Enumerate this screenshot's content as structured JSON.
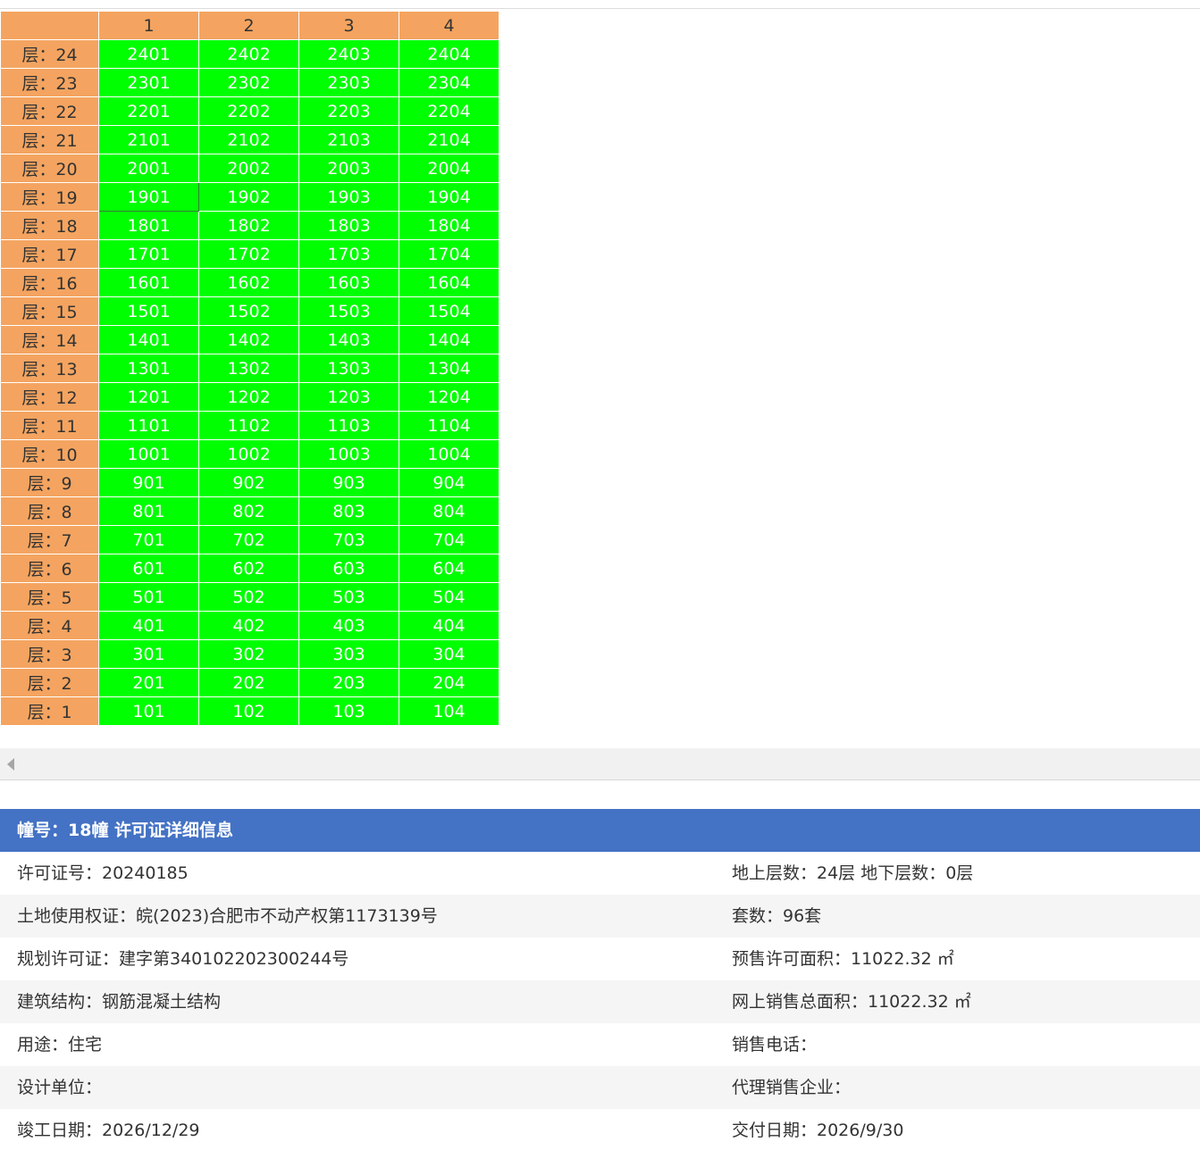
{
  "units_grid": {
    "columns": [
      "1",
      "2",
      "3",
      "4"
    ],
    "floors": [
      {
        "label": "层：24",
        "rooms": [
          "2401",
          "2402",
          "2403",
          "2404"
        ]
      },
      {
        "label": "层：23",
        "rooms": [
          "2301",
          "2302",
          "2303",
          "2304"
        ]
      },
      {
        "label": "层：22",
        "rooms": [
          "2201",
          "2202",
          "2203",
          "2204"
        ]
      },
      {
        "label": "层：21",
        "rooms": [
          "2101",
          "2102",
          "2103",
          "2104"
        ]
      },
      {
        "label": "层：20",
        "rooms": [
          "2001",
          "2002",
          "2003",
          "2004"
        ]
      },
      {
        "label": "层：19",
        "rooms": [
          "1901",
          "1902",
          "1903",
          "1904"
        ]
      },
      {
        "label": "层：18",
        "rooms": [
          "1801",
          "1802",
          "1803",
          "1804"
        ]
      },
      {
        "label": "层：17",
        "rooms": [
          "1701",
          "1702",
          "1703",
          "1704"
        ]
      },
      {
        "label": "层：16",
        "rooms": [
          "1601",
          "1602",
          "1603",
          "1604"
        ]
      },
      {
        "label": "层：15",
        "rooms": [
          "1501",
          "1502",
          "1503",
          "1504"
        ]
      },
      {
        "label": "层：14",
        "rooms": [
          "1401",
          "1402",
          "1403",
          "1404"
        ]
      },
      {
        "label": "层：13",
        "rooms": [
          "1301",
          "1302",
          "1303",
          "1304"
        ]
      },
      {
        "label": "层：12",
        "rooms": [
          "1201",
          "1202",
          "1203",
          "1204"
        ]
      },
      {
        "label": "层：11",
        "rooms": [
          "1101",
          "1102",
          "1103",
          "1104"
        ]
      },
      {
        "label": "层：10",
        "rooms": [
          "1001",
          "1002",
          "1003",
          "1004"
        ]
      },
      {
        "label": "层：9",
        "rooms": [
          "901",
          "902",
          "903",
          "904"
        ]
      },
      {
        "label": "层：8",
        "rooms": [
          "801",
          "802",
          "803",
          "804"
        ]
      },
      {
        "label": "层：7",
        "rooms": [
          "701",
          "702",
          "703",
          "704"
        ]
      },
      {
        "label": "层：6",
        "rooms": [
          "601",
          "602",
          "603",
          "604"
        ]
      },
      {
        "label": "层：5",
        "rooms": [
          "501",
          "502",
          "503",
          "504"
        ]
      },
      {
        "label": "层：4",
        "rooms": [
          "401",
          "402",
          "403",
          "404"
        ]
      },
      {
        "label": "层：3",
        "rooms": [
          "301",
          "302",
          "303",
          "304"
        ]
      },
      {
        "label": "层：2",
        "rooms": [
          "201",
          "202",
          "203",
          "204"
        ]
      },
      {
        "label": "层：1",
        "rooms": [
          "101",
          "102",
          "103",
          "104"
        ]
      }
    ],
    "colors": {
      "header_bg": "#f4a460",
      "available_room_bg": "#00ff00",
      "room_text": "#ffffff"
    }
  },
  "scrollbar": {
    "arrow_icon": "arrow-left-icon"
  },
  "permit_info": {
    "title": "幢号：18幢 许可证详细信息",
    "header_color": "#4472c4",
    "rows": [
      {
        "left": "许可证号：20240185",
        "right": "地上层数：24层  地下层数：0层"
      },
      {
        "left": "土地使用权证：皖(2023)合肥市不动产权第1173139号",
        "right": "套数：96套"
      },
      {
        "left": "规划许可证：建字第340102202300244号",
        "right": "预售许可面积：11022.32 ㎡"
      },
      {
        "left": "建筑结构：钢筋混凝土结构",
        "right": "网上销售总面积：11022.32 ㎡"
      },
      {
        "left": "用途：住宅",
        "right": "销售电话："
      },
      {
        "left": "设计单位：",
        "right": "代理销售企业："
      },
      {
        "left": "竣工日期：2026/12/29",
        "right": "交付日期：2026/9/30"
      }
    ]
  }
}
